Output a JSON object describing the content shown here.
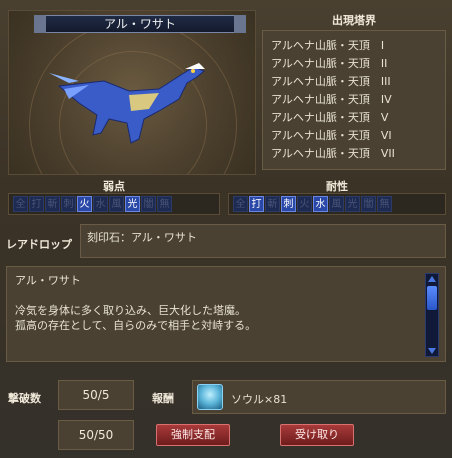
{
  "monster": {
    "name": "アル・ワサト"
  },
  "tower": {
    "title": "出現塔界",
    "items": [
      "アルヘナ山脈・天頂　I",
      "アルヘナ山脈・天頂　II",
      "アルヘナ山脈・天頂　III",
      "アルヘナ山脈・天頂　IV",
      "アルヘナ山脈・天頂　V",
      "アルヘナ山脈・天頂　VI",
      "アルヘナ山脈・天頂　VII"
    ]
  },
  "weakness": {
    "title": "弱点",
    "cells": [
      {
        "label": "全",
        "on": false
      },
      {
        "label": "打",
        "on": false
      },
      {
        "label": "斬",
        "on": false
      },
      {
        "label": "刺",
        "on": false
      },
      {
        "label": "火",
        "on": true
      },
      {
        "label": "水",
        "on": false
      },
      {
        "label": "風",
        "on": false
      },
      {
        "label": "光",
        "on": true
      },
      {
        "label": "闇",
        "on": false
      },
      {
        "label": "無",
        "on": false
      }
    ]
  },
  "resistance": {
    "title": "耐性",
    "cells": [
      {
        "label": "全",
        "on": false
      },
      {
        "label": "打",
        "on": true
      },
      {
        "label": "斬",
        "on": false
      },
      {
        "label": "刺",
        "on": true
      },
      {
        "label": "火",
        "on": false
      },
      {
        "label": "水",
        "on": true
      },
      {
        "label": "風",
        "on": false
      },
      {
        "label": "光",
        "on": false
      },
      {
        "label": "闇",
        "on": false
      },
      {
        "label": "無",
        "on": false
      }
    ]
  },
  "rare_drop": {
    "label": "レアドロップ",
    "value": "刻印石：アル・ワサト"
  },
  "description": {
    "title": "アル・ワサト",
    "line1": "冷気を身体に多く取り込み、巨大化した塔魔。",
    "line2": "孤高の存在として、自らのみで相手と対峙する。"
  },
  "kills": {
    "label": "撃破数",
    "value1": "50/5",
    "value2": "50/50"
  },
  "reward": {
    "label": "報酬",
    "text": "ソウル×81",
    "icon": "soul-icon"
  },
  "buttons": {
    "force": "強制支配",
    "receive": "受け取り"
  },
  "colors": {
    "attr_on": "#2a48a8",
    "attr_off": "#1d2a52",
    "button": "#a83a3a"
  }
}
